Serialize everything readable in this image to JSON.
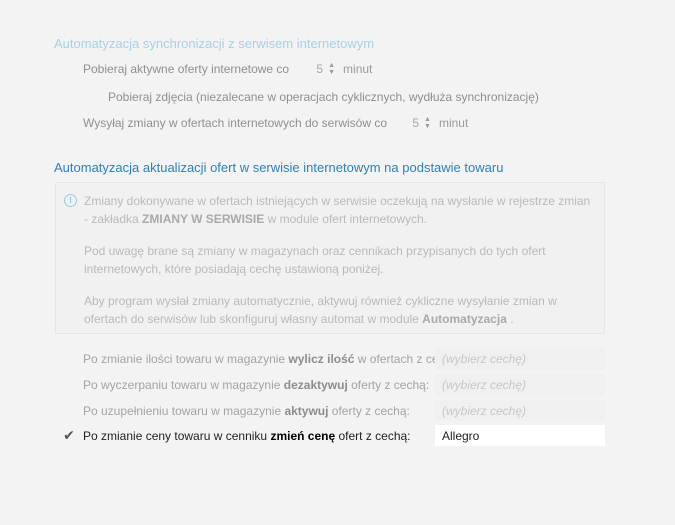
{
  "sync_section": {
    "title": "Automatyzacja synchronizacji z serwisem internetowym",
    "fetch_offers": {
      "label": "Pobieraj aktywne oferty internetowe co",
      "value": "5",
      "unit": "minut"
    },
    "fetch_images": {
      "label": "Pobieraj zdjęcia (niezalecane w operacjach cyklicznych, wydłuża synchronizację)"
    },
    "send_changes": {
      "label": "Wysyłaj zmiany w ofertach internetowych do serwisów co",
      "value": "5",
      "unit": "minut"
    }
  },
  "update_section": {
    "title": "Automatyzacja aktualizacji ofert w serwisie internetowym na podstawie towaru",
    "info": {
      "p1_before": "Zmiany dokonywane w ofertach istniejących w serwisie oczekują na wysłanie w rejestrze zmian - zakładka ",
      "p1_bold": "ZMIANY W SERWISIE",
      "p1_after": " w module ofert internetowych.",
      "p2": "Pod uwagę brane są zmiany w magazynach oraz cennikach przypisanych do tych ofert internetowych, które posiadają cechę ustawioną poniżej.",
      "p3_before": "Aby program wysłał zmiany automatycznie, aktywuj również cykliczne wysyłanie zmian w ofertach do serwisów lub skonfiguruj własny automat w module ",
      "p3_bold": "Automatyzacja",
      "p3_after": " ."
    },
    "rules": [
      {
        "pre": "Po zmianie ilości towaru w magazynie ",
        "bold": "wylicz ilość",
        "post": " w ofertach z cechą:",
        "value": "(wybierz cechę)",
        "checked": false
      },
      {
        "pre": "Po wyczerpaniu towaru w magazynie ",
        "bold": "dezaktywuj",
        "post": " oferty z cechą:",
        "value": "(wybierz cechę)",
        "checked": false
      },
      {
        "pre": "Po uzupełnieniu towaru w magazynie ",
        "bold": "aktywuj",
        "post": " oferty z cechą:",
        "value": "(wybierz cechę)",
        "checked": false
      },
      {
        "pre": "Po zmianie ceny towaru w cenniku ",
        "bold": "zmień cenę",
        "post": " ofert z cechą:",
        "value": "Allegro",
        "checked": true
      }
    ]
  },
  "icons": {
    "info": "info-icon",
    "check": "checkmark-icon",
    "spinner": "spinner-arrows-icon"
  },
  "colors": {
    "background": "#f3f3f3",
    "accent": "#2f7fb8",
    "accent_disabled": "#a9cfe3"
  }
}
